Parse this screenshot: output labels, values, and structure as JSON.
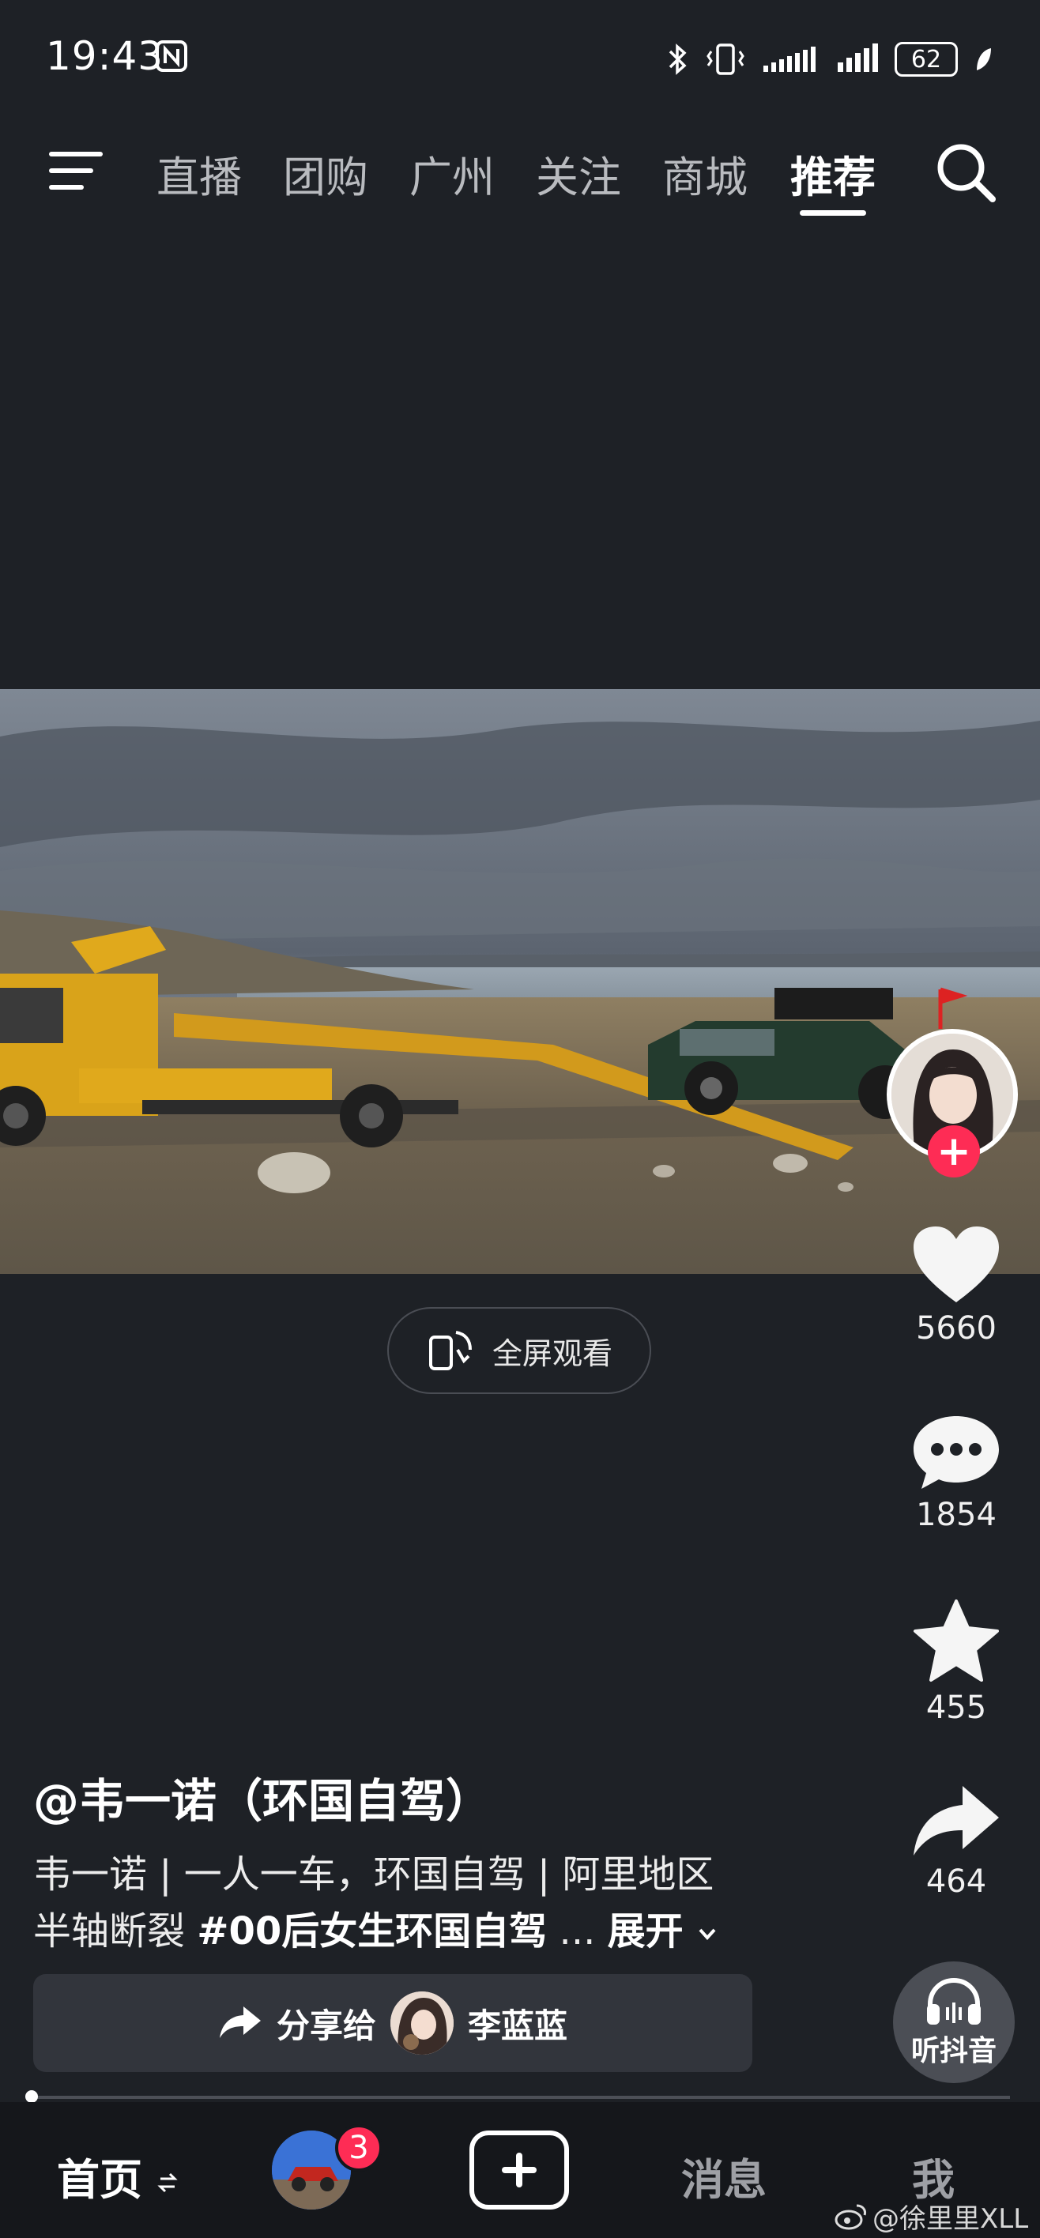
{
  "status_bar": {
    "time": "19:43",
    "battery": "62"
  },
  "top_nav": {
    "tabs": [
      "直播",
      "团购",
      "广州",
      "关注",
      "商城",
      "推荐"
    ],
    "active_tab": "推荐"
  },
  "video": {
    "fullscreen_label": "全屏观看"
  },
  "actions": {
    "likes": "5660",
    "comments": "1854",
    "favorites": "455",
    "shares": "464",
    "follow_symbol": "+"
  },
  "caption": {
    "author": "@韦一诺（环国自驾）",
    "line1": "韦一诺 | 一人一车，环国自驾 | 阿里地区",
    "line2_text": "半轴断裂 ",
    "hashtag": "#00后女生环国自驾",
    "ellipsis": " ... ",
    "expand": "展开"
  },
  "share_bar": {
    "label": "分享给",
    "target": "李蓝蓝"
  },
  "listen": {
    "label": "听抖音"
  },
  "bottom_nav": {
    "home": "首页",
    "badge": "3",
    "messages": "消息",
    "me": "我"
  },
  "watermark": "@徐里里XLL",
  "colors": {
    "background": "#1e2126",
    "accent": "#fe2c55",
    "text": "#ffffff"
  }
}
